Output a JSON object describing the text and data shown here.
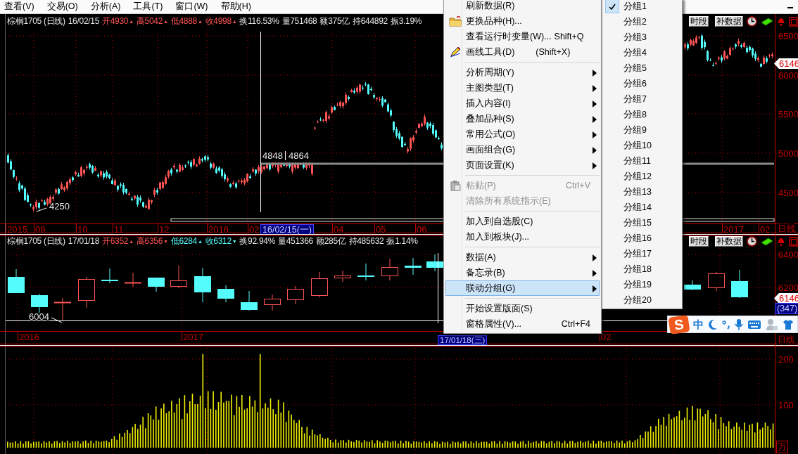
{
  "menubar": [
    {
      "label": "查看(V)"
    },
    {
      "label": "交易(O)"
    },
    {
      "label": "分析(A)"
    },
    {
      "label": "工具(T)"
    },
    {
      "label": "窗口(W)"
    },
    {
      "label": "帮助(H)"
    }
  ],
  "panels": [
    {
      "kind": "price",
      "header": [
        {
          "text": "棕榈1705 (日线)",
          "color": "#e6e6e6"
        },
        {
          "text": "16/02/15",
          "color": "#e6e6e6"
        },
        {
          "text": "开4930",
          "color": "#ff5454",
          "arrow": "▲"
        },
        {
          "text": "高5042",
          "color": "#ff5454",
          "arrow": "▲"
        },
        {
          "text": "低4888",
          "color": "#ff5454",
          "arrow": "▲"
        },
        {
          "text": "收4998",
          "color": "#ff5454",
          "arrow": "▲"
        },
        {
          "text": "换116.53%",
          "color": "#e6e6e6"
        },
        {
          "text": "量751468",
          "color": "#e6e6e6"
        },
        {
          "text": "额375亿",
          "color": "#e6e6e6"
        },
        {
          "text": "持644892",
          "color": "#e6e6e6"
        },
        {
          "text": "振3.19%",
          "color": "#e6e6e6"
        }
      ],
      "tools": [
        "时段",
        "补数据"
      ],
      "y_axis": [
        "6500",
        "6000",
        "5500",
        "5000",
        "4500"
      ],
      "price_tag": "6146",
      "x_axis": [
        "2015",
        "09",
        "10",
        "11",
        "12",
        "2016",
        "02",
        "04",
        "05",
        "06",
        "2017",
        "02"
      ],
      "cursor_date": "16/02/15(一)",
      "annotations": [
        "4848",
        "4864",
        "4250"
      ],
      "period": "日线"
    },
    {
      "kind": "price",
      "header": [
        {
          "text": "棕榈1705 (日线)",
          "color": "#e6e6e6"
        },
        {
          "text": "17/01/18",
          "color": "#e6e6e6"
        },
        {
          "text": "开6352",
          "color": "#ff5454",
          "arrow": "▲"
        },
        {
          "text": "高6356",
          "color": "#ff5454",
          "arrow": "▼"
        },
        {
          "text": "低6284",
          "color": "#54fcfc",
          "arrow": "▲"
        },
        {
          "text": "收6312",
          "color": "#54fcfc",
          "arrow": "▼"
        },
        {
          "text": "换92.94%",
          "color": "#e6e6e6"
        },
        {
          "text": "量451366",
          "color": "#e6e6e6"
        },
        {
          "text": "额285亿",
          "color": "#e6e6e6"
        },
        {
          "text": "持485632",
          "color": "#e6e6e6"
        },
        {
          "text": "振1.14%",
          "color": "#e6e6e6"
        }
      ],
      "tools": [
        "时段",
        "补数据"
      ],
      "y_axis": [
        "6400",
        "6200"
      ],
      "price_tag": "6146",
      "count_tag": "(347)",
      "x_axis": [
        "2016",
        "2017",
        "02"
      ],
      "cursor_date": "17/01/18(三)",
      "annotations": [
        "6004"
      ],
      "period": "日线"
    },
    {
      "kind": "volume",
      "y_axis": [
        "200",
        "100"
      ],
      "unit": "万"
    }
  ],
  "context_menu": {
    "items": [
      {
        "kind": "item",
        "label": "刷新数据(R)",
        "submenu": false,
        "disabled": false,
        "selected": false
      },
      {
        "kind": "item",
        "label": "更换品种(H)...",
        "submenu": false,
        "disabled": false,
        "selected": false
      },
      {
        "kind": "item",
        "label": "查看运行时变量(W)...",
        "shortcut": "Shift+Q",
        "submenu": false,
        "disabled": false,
        "selected": false
      },
      {
        "kind": "item",
        "label": "画线工具(D)",
        "shortcut": "(Shift+X)",
        "submenu": false,
        "disabled": false,
        "selected": false
      },
      {
        "kind": "separator"
      },
      {
        "kind": "item",
        "label": "分析周期(Y)",
        "submenu": true,
        "disabled": false,
        "selected": false
      },
      {
        "kind": "item",
        "label": "主图类型(T)",
        "submenu": true,
        "disabled": false,
        "selected": false
      },
      {
        "kind": "item",
        "label": "插入内容(I)",
        "submenu": true,
        "disabled": false,
        "selected": false
      },
      {
        "kind": "item",
        "label": "叠加品种(S)",
        "submenu": true,
        "disabled": false,
        "selected": false
      },
      {
        "kind": "item",
        "label": "常用公式(O)",
        "submenu": true,
        "disabled": false,
        "selected": false
      },
      {
        "kind": "item",
        "label": "画面组合(G)",
        "submenu": true,
        "disabled": false,
        "selected": false
      },
      {
        "kind": "item",
        "label": "页面设置(K)",
        "submenu": true,
        "disabled": false,
        "selected": false
      },
      {
        "kind": "separator"
      },
      {
        "kind": "item",
        "label": "粘贴(P)",
        "shortcut": "Ctrl+V",
        "submenu": false,
        "disabled": true,
        "selected": false
      },
      {
        "kind": "item",
        "label": "清除所有系统指示(E)",
        "submenu": false,
        "disabled": true,
        "selected": false
      },
      {
        "kind": "separator"
      },
      {
        "kind": "item",
        "label": "加入到自选股(C)",
        "submenu": false,
        "disabled": false,
        "selected": false
      },
      {
        "kind": "item",
        "label": "加入到板块(J)...",
        "submenu": false,
        "disabled": false,
        "selected": false
      },
      {
        "kind": "separator"
      },
      {
        "kind": "item",
        "label": "数据(A)",
        "submenu": true,
        "disabled": false,
        "selected": false
      },
      {
        "kind": "item",
        "label": "备忘录(B)",
        "submenu": true,
        "disabled": false,
        "selected": false
      },
      {
        "kind": "item",
        "label": "联动分组(G)",
        "submenu": true,
        "disabled": false,
        "selected": true
      },
      {
        "kind": "separator"
      },
      {
        "kind": "item",
        "label": "开始设置版面(S)",
        "submenu": false,
        "disabled": false,
        "selected": false
      },
      {
        "kind": "item",
        "label": "窗格属性(V)...",
        "shortcut": "Ctrl+F4",
        "submenu": false,
        "disabled": false,
        "selected": false
      }
    ]
  },
  "submenu": {
    "items": [
      {
        "label": "分组1",
        "checked": true
      },
      {
        "label": "分组2",
        "checked": false
      },
      {
        "label": "分组3",
        "checked": false
      },
      {
        "label": "分组4",
        "checked": false
      },
      {
        "label": "分组5",
        "checked": false
      },
      {
        "label": "分组6",
        "checked": false
      },
      {
        "label": "分组7",
        "checked": false
      },
      {
        "label": "分组8",
        "checked": false
      },
      {
        "label": "分组9",
        "checked": false
      },
      {
        "label": "分组10",
        "checked": false
      },
      {
        "label": "分组11",
        "checked": false
      },
      {
        "label": "分组12",
        "checked": false
      },
      {
        "label": "分组13",
        "checked": false
      },
      {
        "label": "分组14",
        "checked": false
      },
      {
        "label": "分组15",
        "checked": false
      },
      {
        "label": "分组16",
        "checked": false
      },
      {
        "label": "分组17",
        "checked": false
      },
      {
        "label": "分组18",
        "checked": false
      },
      {
        "label": "分组19",
        "checked": false
      },
      {
        "label": "分组20",
        "checked": false
      }
    ]
  },
  "ime_toolbar": {
    "logo": "S",
    "mode": "中"
  }
}
